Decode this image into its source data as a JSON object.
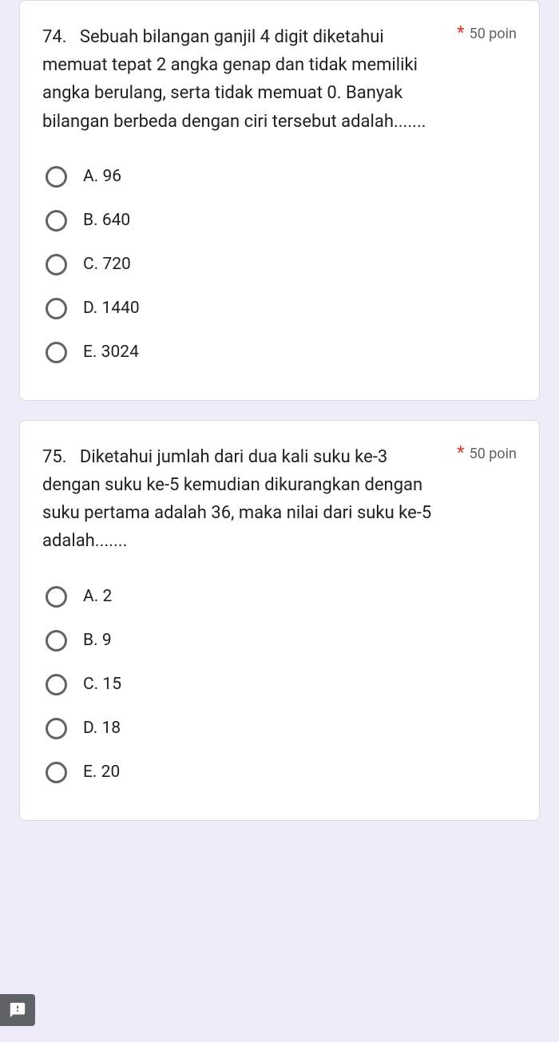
{
  "questions": [
    {
      "number": "74.",
      "text": "Sebuah bilangan ganjil 4 digit diketahui memuat tepat 2 angka genap dan tidak memiliki angka berulang, serta tidak memuat 0. Banyak bilangan berbeda dengan ciri tersebut adalah.......",
      "required_mark": "*",
      "points": "50 poin",
      "options": [
        {
          "label": "A. 96"
        },
        {
          "label": "B. 640"
        },
        {
          "label": "C. 720"
        },
        {
          "label": "D. 1440"
        },
        {
          "label": "E. 3024"
        }
      ]
    },
    {
      "number": "75.",
      "text": "Diketahui jumlah dari dua kali suku ke-3 dengan suku ke-5 kemudian dikurangkan dengan suku pertama adalah 36, maka nilai dari suku ke-5 adalah.......",
      "required_mark": "*",
      "points": "50 poin",
      "options": [
        {
          "label": "A. 2"
        },
        {
          "label": "B. 9"
        },
        {
          "label": "C. 15"
        },
        {
          "label": "D. 18"
        },
        {
          "label": "E. 20"
        }
      ]
    }
  ]
}
